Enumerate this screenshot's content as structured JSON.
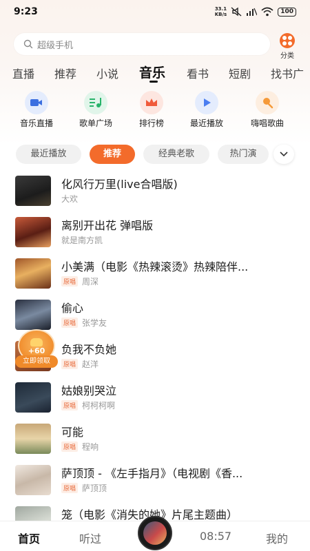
{
  "status_bar": {
    "time": "9:23",
    "net_speed_value": "33.1",
    "net_speed_unit": "KB/s",
    "battery": "100"
  },
  "search": {
    "placeholder": "超级手机"
  },
  "category": {
    "label": "分类"
  },
  "channel_tabs": [
    "直播",
    "推荐",
    "小说",
    "音乐",
    "看书",
    "短剧",
    "找书广"
  ],
  "active_channel": "音乐",
  "quick_entries": [
    {
      "label": "音乐直播",
      "icon": "camera-icon",
      "color": "#3b6fe0"
    },
    {
      "label": "歌单广场",
      "icon": "playlist-icon",
      "color": "#27b36a"
    },
    {
      "label": "排行榜",
      "icon": "crown-icon",
      "color": "#f05a3a"
    },
    {
      "label": "最近播放",
      "icon": "play-icon",
      "color": "#4a7df0"
    },
    {
      "label": "嗨唱歌曲",
      "icon": "microphone-icon",
      "color": "#f59a3a"
    }
  ],
  "filter_chips": [
    "最近播放",
    "推荐",
    "经典老歌",
    "热门演"
  ],
  "active_filter": "推荐",
  "songs": [
    {
      "title": "化风行万里(live合唱版)",
      "artist": "大欢",
      "original": false
    },
    {
      "title": "离别开出花 弹唱版",
      "artist": "就是南方凯",
      "original": false
    },
    {
      "title": "小美满（电影《热辣滚烫》热辣陪伴...",
      "artist": "周深",
      "original": true
    },
    {
      "title": "偷心",
      "artist": "张学友",
      "original": true
    },
    {
      "title": "负我不负她",
      "artist": "赵洋",
      "original": true
    },
    {
      "title": "姑娘别哭泣",
      "artist": "柯柯柯啊",
      "original": true
    },
    {
      "title": "可能",
      "artist": "程响",
      "original": true
    },
    {
      "title": "萨顶顶 - 《左手指月》（电视剧《香...",
      "artist": "萨顶顶",
      "original": true
    },
    {
      "title": "笼（电影《消失的她》片尾主题曲）",
      "artist": "",
      "original": false
    }
  ],
  "original_badge": "原唱",
  "reward": {
    "amount": "+60",
    "label": "立即领取"
  },
  "bottom_nav": {
    "home": "首页",
    "listened": "听过",
    "time": "08:57",
    "mine": "我的"
  }
}
